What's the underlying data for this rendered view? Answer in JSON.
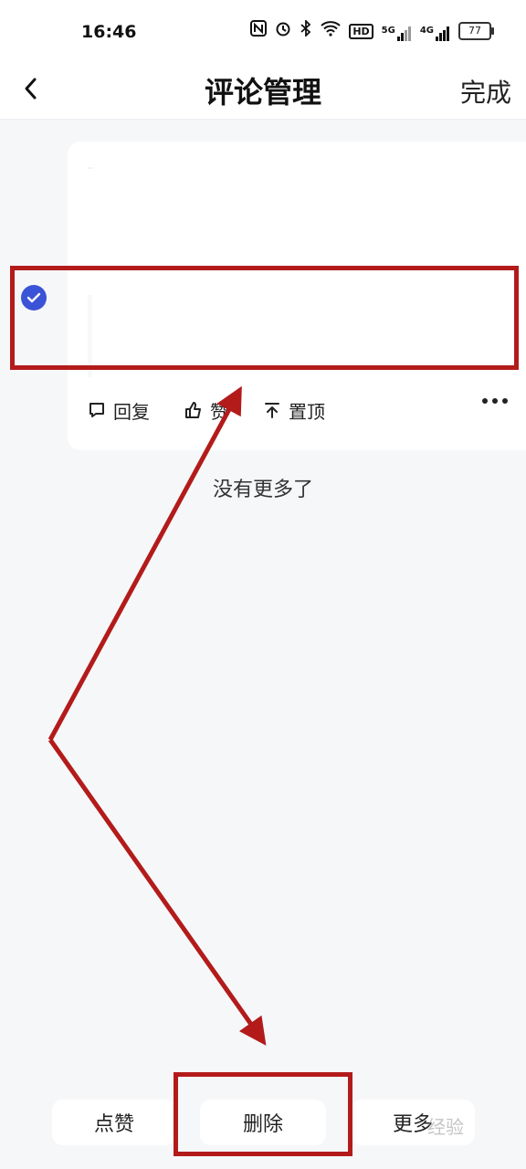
{
  "status_bar": {
    "time": "16:46",
    "icons": [
      "nfc-icon",
      "alarm-icon",
      "bluetooth-icon",
      "wifi-icon",
      "hd-icon",
      "5g-signal-icon",
      "4g-signal-icon"
    ],
    "net_5g": "5G",
    "net_4g": "4G",
    "hd": "HD",
    "battery": "77"
  },
  "header": {
    "title": "评论管理",
    "done_label": "完成"
  },
  "comment_card": {
    "selected": true,
    "actions": {
      "reply": "回复",
      "like": "赞",
      "pin": "置顶"
    }
  },
  "list_footer": "没有更多了",
  "bottom_bar": {
    "like": "点赞",
    "delete": "删除",
    "more": "更多"
  },
  "watermark": "经验",
  "colors": {
    "accent": "#3b53d6",
    "annotation": "#b31b1b",
    "background": "#f6f7f9"
  }
}
